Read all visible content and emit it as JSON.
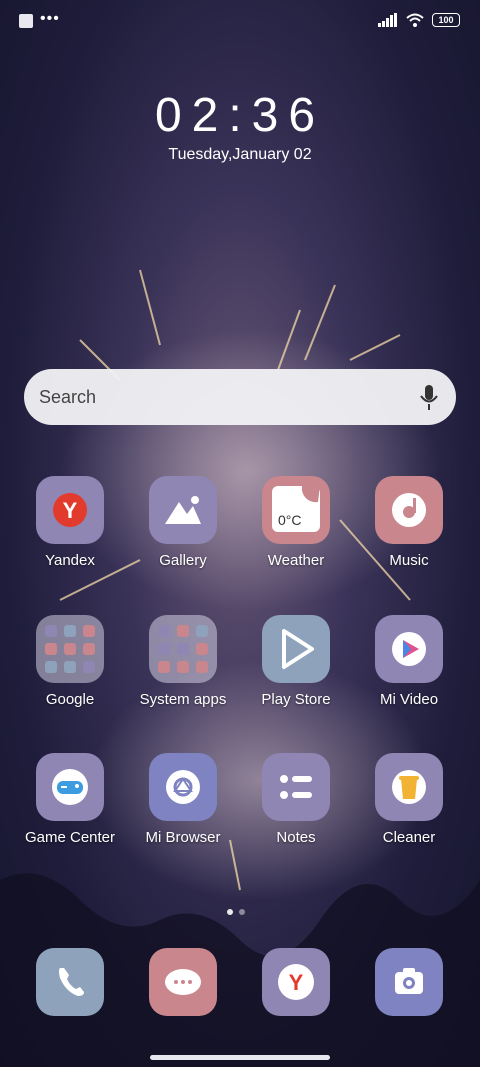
{
  "status_bar": {
    "battery": "100"
  },
  "lock": {
    "time": "02:36",
    "date": "Tuesday,January 02"
  },
  "search": {
    "placeholder": "Search"
  },
  "apps": [
    {
      "label": "Yandex"
    },
    {
      "label": "Gallery"
    },
    {
      "label": "Weather",
      "temp": "0°C"
    },
    {
      "label": "Music"
    },
    {
      "label": "Google"
    },
    {
      "label": "System apps"
    },
    {
      "label": "Play Store"
    },
    {
      "label": "Mi Video"
    },
    {
      "label": "Game Center"
    },
    {
      "label": "Mi Browser"
    },
    {
      "label": "Notes"
    },
    {
      "label": "Cleaner"
    }
  ],
  "dock": [
    "Phone",
    "Messaging",
    "Browser",
    "Camera"
  ],
  "colors": {
    "tile_purple": "#8f86b3",
    "tile_pink": "#c9868d",
    "tile_blue": "#8ea3bb",
    "yandex_red": "#e23b2e"
  }
}
